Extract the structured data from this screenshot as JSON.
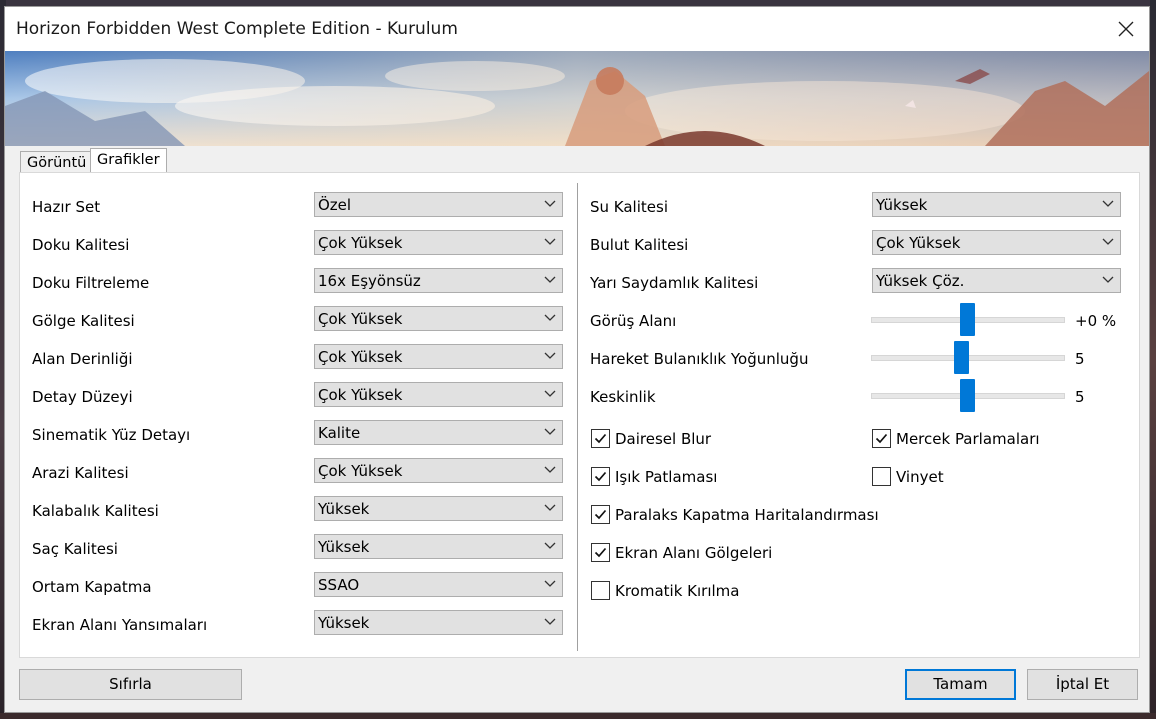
{
  "window": {
    "title": "Horizon Forbidden West Complete Edition - Kurulum"
  },
  "tabs": [
    {
      "label": "Görüntü",
      "active": false
    },
    {
      "label": "Grafikler",
      "active": true
    }
  ],
  "left_settings": [
    {
      "label": "Hazır Set",
      "value": "Özel"
    },
    {
      "label": "Doku Kalitesi",
      "value": "Çok Yüksek"
    },
    {
      "label": "Doku Filtreleme",
      "value": "16x Eşyönsüz"
    },
    {
      "label": "Gölge Kalitesi",
      "value": "Çok Yüksek"
    },
    {
      "label": "Alan Derinliği",
      "value": "Çok Yüksek"
    },
    {
      "label": "Detay Düzeyi",
      "value": "Çok Yüksek"
    },
    {
      "label": "Sinematik Yüz Detayı",
      "value": "Kalite"
    },
    {
      "label": "Arazi Kalitesi",
      "value": "Çok Yüksek"
    },
    {
      "label": "Kalabalık Kalitesi",
      "value": "Yüksek"
    },
    {
      "label": "Saç Kalitesi",
      "value": "Yüksek"
    },
    {
      "label": "Ortam Kapatma",
      "value": "SSAO"
    },
    {
      "label": "Ekran Alanı Yansımaları",
      "value": "Yüksek"
    }
  ],
  "right_selects": [
    {
      "label": "Su Kalitesi",
      "value": "Yüksek"
    },
    {
      "label": "Bulut Kalitesi",
      "value": "Çok Yüksek"
    },
    {
      "label": "Yarı Saydamlık Kalitesi",
      "value": "Yüksek Çöz."
    }
  ],
  "sliders": [
    {
      "label": "Görüş Alanı",
      "value_text": "+0 %",
      "position": 0.5
    },
    {
      "label": "Hareket Bulanıklık Yoğunluğu",
      "value_text": "5",
      "position": 0.47
    },
    {
      "label": "Keskinlik",
      "value_text": "5",
      "position": 0.5
    }
  ],
  "checkboxes": [
    {
      "label": "Dairesel Blur",
      "checked": true
    },
    {
      "label": "Işık Patlaması",
      "checked": true
    },
    {
      "label": "Paralaks Kapatma Haritalandırması",
      "checked": true
    },
    {
      "label": "Ekran Alanı Gölgeleri",
      "checked": true
    },
    {
      "label": "Kromatik Kırılma",
      "checked": false
    },
    {
      "label": "Mercek Parlamaları",
      "checked": true
    },
    {
      "label": "Vinyet",
      "checked": false
    }
  ],
  "buttons": {
    "reset": "Sıfırla",
    "ok": "Tamam",
    "cancel": "İptal Et"
  },
  "colors": {
    "accent": "#0078d7",
    "window_bg": "#f0f0f0",
    "panel_bg": "#ffffff",
    "control_bg": "#e1e1e1"
  },
  "icons": {
    "close": "close-icon",
    "dropdown": "chevron-down-icon",
    "check": "checkmark-icon"
  }
}
